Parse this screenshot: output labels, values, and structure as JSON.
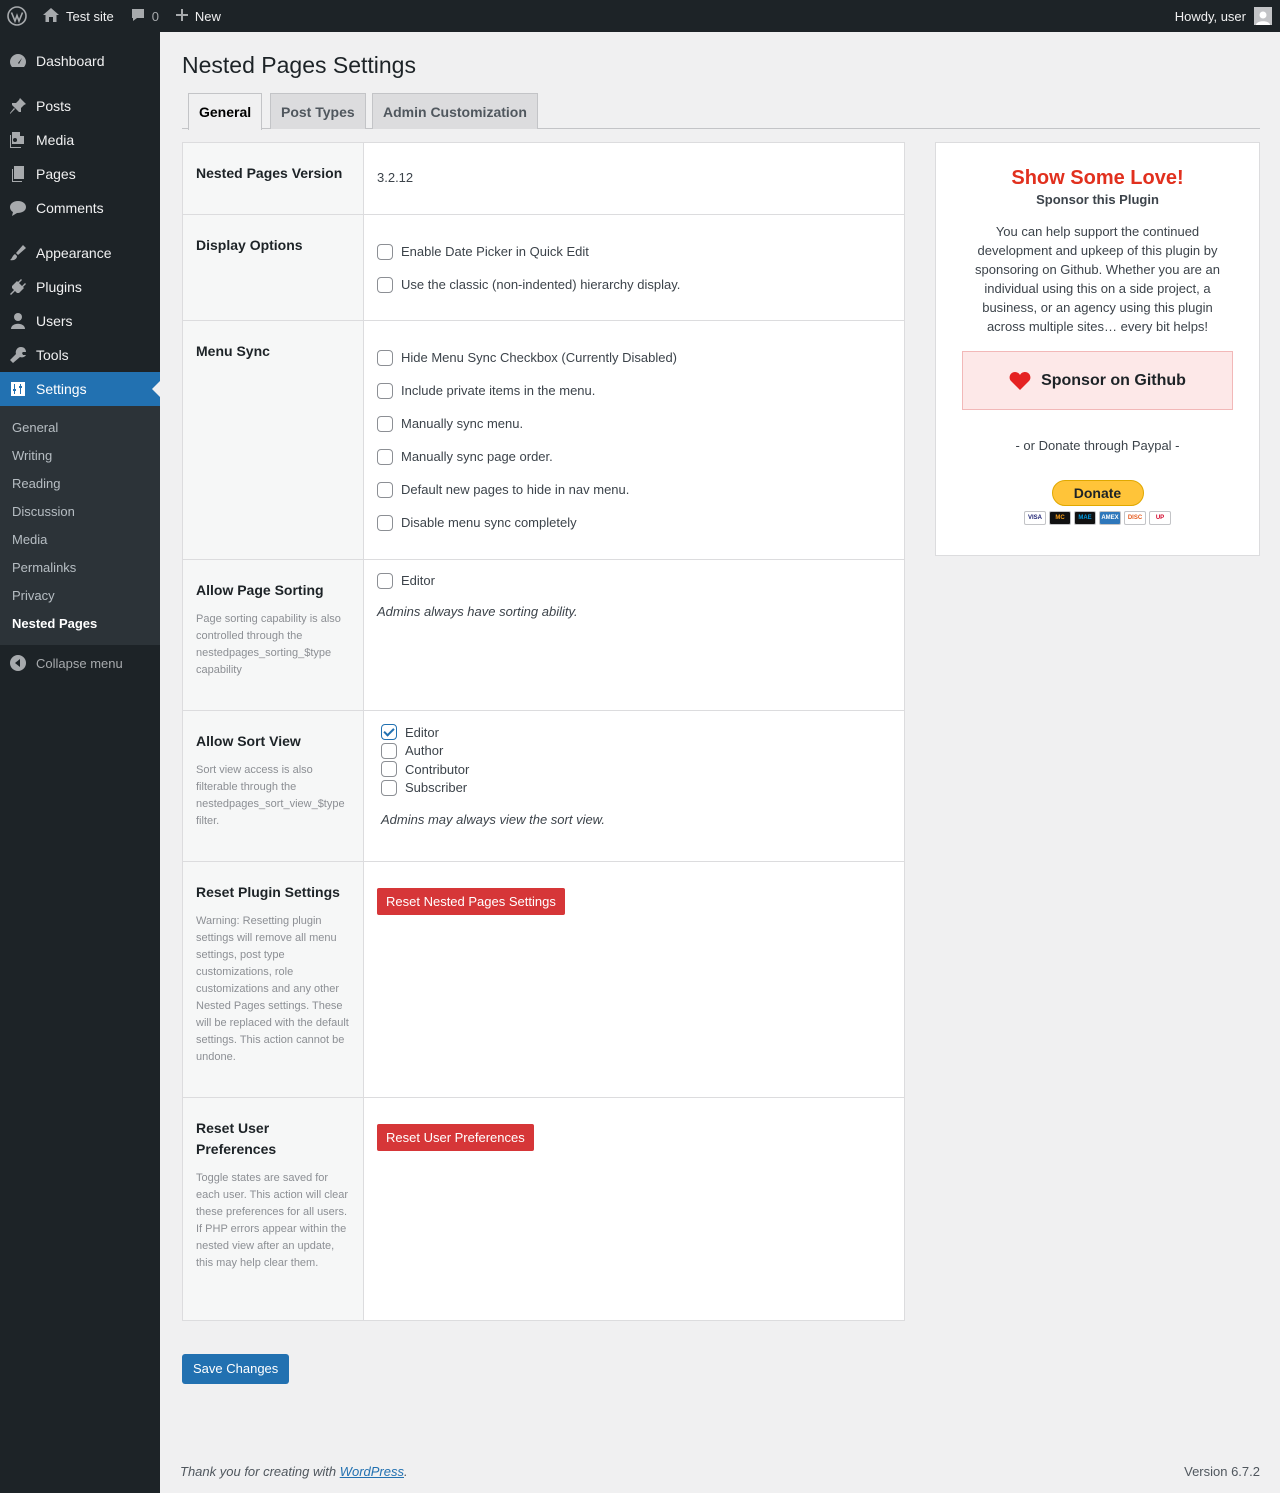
{
  "adminbar": {
    "site_name": "Test site",
    "comments_count": "0",
    "new_label": "New",
    "howdy": "Howdy, user"
  },
  "sidebar": {
    "items": [
      {
        "label": "Dashboard",
        "icon": "dashboard-icon"
      },
      {
        "label": "Posts",
        "icon": "pin-icon"
      },
      {
        "label": "Media",
        "icon": "media-icon"
      },
      {
        "label": "Pages",
        "icon": "pages-icon"
      },
      {
        "label": "Comments",
        "icon": "comment-icon"
      },
      {
        "label": "Appearance",
        "icon": "brush-icon"
      },
      {
        "label": "Plugins",
        "icon": "plug-icon"
      },
      {
        "label": "Users",
        "icon": "user-icon"
      },
      {
        "label": "Tools",
        "icon": "wrench-icon"
      },
      {
        "label": "Settings",
        "icon": "settings-icon"
      }
    ],
    "submenu": [
      "General",
      "Writing",
      "Reading",
      "Discussion",
      "Media",
      "Permalinks",
      "Privacy",
      "Nested Pages"
    ],
    "collapse": "Collapse menu"
  },
  "page": {
    "title": "Nested Pages Settings",
    "tabs": [
      "General",
      "Post Types",
      "Admin Customization"
    ]
  },
  "settings": {
    "version": {
      "label": "Nested Pages Version",
      "value": "3.2.12"
    },
    "display": {
      "label": "Display Options",
      "options": [
        "Enable Date Picker in Quick Edit",
        "Use the classic (non-indented) hierarchy display."
      ]
    },
    "menu_sync": {
      "label": "Menu Sync",
      "options": [
        "Hide Menu Sync Checkbox (Currently Disabled)",
        "Include private items in the menu.",
        "Manually sync menu.",
        "Manually sync page order.",
        "Default new pages to hide in nav menu.",
        "Disable menu sync completely"
      ]
    },
    "sorting": {
      "label": "Allow Page Sorting",
      "desc": "Page sorting capability is also controlled through the nestedpages_sorting_$type capability",
      "options": [
        "Editor"
      ],
      "note": "Admins always have sorting ability."
    },
    "sort_view": {
      "label": "Allow Sort View",
      "desc": "Sort view access is also filterable through the nestedpages_sort_view_$type filter.",
      "options": [
        "Editor",
        "Author",
        "Contributor",
        "Subscriber"
      ],
      "note": "Admins may always view the sort view."
    },
    "reset_plugin": {
      "label": "Reset Plugin Settings",
      "desc": "Warning: Resetting plugin settings will remove all menu settings, post type customizations, role customizations and any other Nested Pages settings. These will be replaced with the default settings. This action cannot be undone.",
      "button": "Reset Nested Pages Settings"
    },
    "reset_user": {
      "label": "Reset User Preferences",
      "desc": "Toggle states are saved for each user. This action will clear these preferences for all users. If PHP errors appear within the nested view after an update, this may help clear them.",
      "button": "Reset User Preferences"
    }
  },
  "save_label": "Save Changes",
  "sponsor": {
    "title": "Show Some Love!",
    "subtitle": "Sponsor this Plugin",
    "text": "You can help support the continued development and upkeep of this plugin by sponsoring on Github. Whether you are an individual using this on a side project, a business, or an agency using this plugin across multiple sites… every bit helps!",
    "github_button": "Sponsor on Github",
    "paypal_text": "- or Donate through Paypal -",
    "donate_button": "Donate",
    "cards": [
      "VISA",
      "MC",
      "MAE",
      "AMEX",
      "DISC",
      "UP"
    ]
  },
  "footer": {
    "thanks_prefix": "Thank you for creating with ",
    "wordpress_link": "WordPress",
    "thanks_suffix": ".",
    "version": "Version 6.7.2"
  },
  "colors": {
    "accent": "#2271b1",
    "danger": "#d63638",
    "sponsor_title": "#e1301e"
  }
}
